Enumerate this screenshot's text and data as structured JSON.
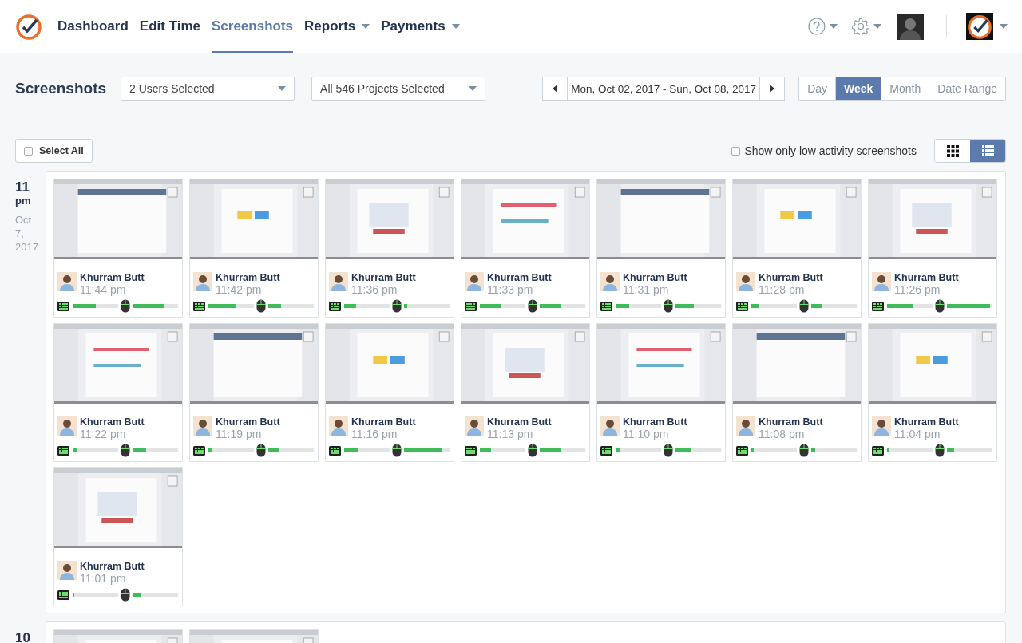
{
  "nav": {
    "items": [
      {
        "label": "Dashboard",
        "selected": false,
        "dropdown": false
      },
      {
        "label": "Edit Time",
        "selected": false,
        "dropdown": false
      },
      {
        "label": "Screenshots",
        "selected": true,
        "dropdown": false
      },
      {
        "label": "Reports",
        "selected": false,
        "dropdown": true
      },
      {
        "label": "Payments",
        "selected": false,
        "dropdown": true
      }
    ]
  },
  "toolbar": {
    "title": "Screenshots",
    "users_select": "2 Users Selected",
    "projects_select": "All 546 Projects Selected",
    "date_range": "Mon, Oct 02, 2017 - Sun, Oct 08, 2017",
    "periods": [
      {
        "label": "Day",
        "selected": false
      },
      {
        "label": "Week",
        "selected": true
      },
      {
        "label": "Month",
        "selected": false
      },
      {
        "label": "Date Range",
        "selected": false
      }
    ]
  },
  "options": {
    "select_all": {
      "label": "Select All",
      "checked": false
    },
    "low_activity": {
      "label": "Show only low activity screenshots",
      "checked": false
    },
    "views": [
      {
        "kind": "grid",
        "selected": false
      },
      {
        "kind": "list",
        "selected": true
      }
    ]
  },
  "groups": [
    {
      "hour": "11",
      "meridiem": "pm",
      "date_lines": [
        "Oct",
        "7,",
        "2017"
      ],
      "shots": [
        {
          "user": "Khurram Butt",
          "time": "11:44 pm",
          "keyboard": {
            "level": 0.5
          },
          "mouse": {
            "level": 0.68
          }
        },
        {
          "user": "Khurram Butt",
          "time": "11:42 pm",
          "keyboard": {
            "level": 0.6
          },
          "mouse": {
            "level": 0.28
          }
        },
        {
          "user": "Khurram Butt",
          "time": "11:36 pm",
          "keyboard": {
            "level": 0.27
          },
          "mouse": {
            "level": 0.07
          }
        },
        {
          "user": "Khurram Butt",
          "time": "11:33 pm",
          "keyboard": {
            "level": 0.45
          },
          "mouse": {
            "level": 0.45
          }
        },
        {
          "user": "Khurram Butt",
          "time": "11:31 pm",
          "keyboard": {
            "level": 0.3
          },
          "mouse": {
            "level": 0.4
          }
        },
        {
          "user": "Khurram Butt",
          "time": "11:28 pm",
          "keyboard": {
            "level": 0.18
          },
          "mouse": {
            "level": 0.24
          }
        },
        {
          "user": "Khurram Butt",
          "time": "11:26 pm",
          "keyboard": {
            "level": 0.57
          },
          "mouse": {
            "level": 0.95
          }
        },
        {
          "user": "Khurram Butt",
          "time": "11:22 pm",
          "keyboard": {
            "level": 0.08
          },
          "mouse": {
            "level": 0.3
          }
        },
        {
          "user": "Khurram Butt",
          "time": "11:19 pm",
          "keyboard": {
            "level": 0.07
          },
          "mouse": {
            "level": 0.25
          }
        },
        {
          "user": "Khurram Butt",
          "time": "11:16 pm",
          "keyboard": {
            "level": 0.3
          },
          "mouse": {
            "level": 0.85
          }
        },
        {
          "user": "Khurram Butt",
          "time": "11:13 pm",
          "keyboard": {
            "level": 0.25
          },
          "mouse": {
            "level": 0.45
          }
        },
        {
          "user": "Khurram Butt",
          "time": "11:10 pm",
          "keyboard": {
            "level": 0.08
          },
          "mouse": {
            "level": 0.35
          }
        },
        {
          "user": "Khurram Butt",
          "time": "11:08 pm",
          "keyboard": {
            "level": 0.05
          },
          "mouse": {
            "level": 0.08
          }
        },
        {
          "user": "Khurram Butt",
          "time": "11:04 pm",
          "keyboard": {
            "level": 0.05
          },
          "mouse": {
            "level": 0.15
          }
        },
        {
          "user": "Khurram Butt",
          "time": "11:01 pm",
          "keyboard": {
            "level": 0.03
          },
          "mouse": {
            "level": 0.18
          }
        }
      ]
    },
    {
      "hour": "10"
    }
  ]
}
